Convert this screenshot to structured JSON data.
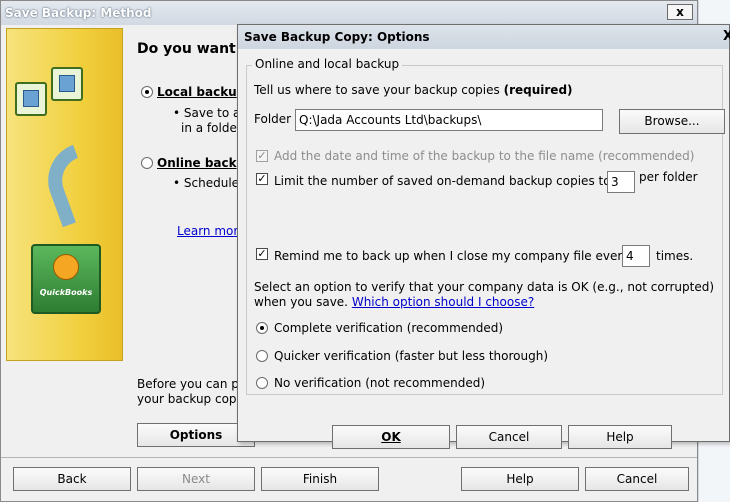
{
  "back_window": {
    "title": "Save Backup: Method",
    "close": "x",
    "heading": "Do you want",
    "local_option": "Local backu",
    "local_bullet_1": "• Save to a",
    "local_bullet_2": "in a folder",
    "online_option": "Online back",
    "online_bullet": "• Schedule",
    "learn_more": "Learn mor",
    "before_text_1": "Before you can p",
    "before_text_2": "your backup copi",
    "options_button": "Options",
    "logo_text": "QuickBooks"
  },
  "footer": {
    "back": "Back",
    "next": "Next",
    "finish": "Finish",
    "help": "Help",
    "cancel": "Cancel"
  },
  "dialog": {
    "title": "Save Backup Copy: Options",
    "close": "X",
    "group_label": "Online and local backup",
    "instruction_text": "Tell us where to save your backup copies ",
    "instruction_bold": "(required)",
    "folder_label": "Folder",
    "folder_value": "Q:\\Jada Accounts Ltd\\backups\\",
    "browse_button": "Browse...",
    "add_date_label": "Add the date and time of the backup to the file name (recommended)",
    "add_date_checked": true,
    "add_date_disabled": true,
    "limit_label": "Limit the number of saved on-demand backup copies to",
    "limit_checked": true,
    "limit_value": "3",
    "limit_suffix": "per folder",
    "remind_label": "Remind me to back up when I close my company file every",
    "remind_checked": true,
    "remind_value": "4",
    "remind_suffix": "times.",
    "verify_text_1": "Select an option to verify that your company data is OK (e.g., not corrupted)",
    "verify_text_2": "when you save.",
    "verify_link": "Which option should I choose?",
    "opt_complete": "Complete verification (recommended)",
    "opt_quicker": "Quicker verification (faster but less thorough)",
    "opt_none": "No verification (not recommended)",
    "selected_option": "complete",
    "ok": "OK",
    "cancel": "Cancel",
    "help": "Help"
  }
}
